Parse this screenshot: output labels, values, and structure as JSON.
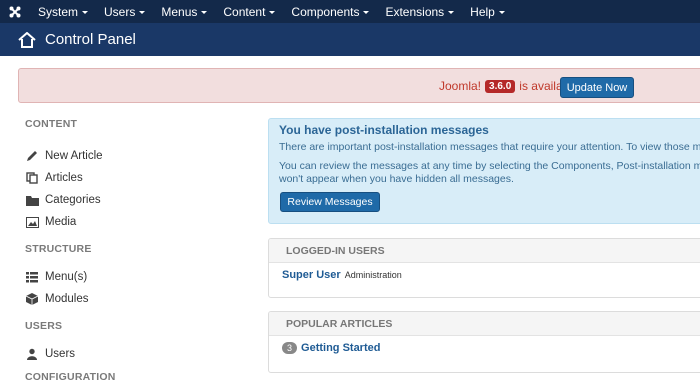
{
  "top_menu": {
    "items": [
      {
        "label": "System"
      },
      {
        "label": "Users"
      },
      {
        "label": "Menus"
      },
      {
        "label": "Content"
      },
      {
        "label": "Components"
      },
      {
        "label": "Extensions"
      },
      {
        "label": "Help"
      }
    ]
  },
  "header": {
    "title": "Control Panel"
  },
  "update_bar": {
    "prefix": "Joomla!",
    "version": "3.6.0",
    "suffix": "is available:",
    "button": "Update Now"
  },
  "sidebar": {
    "content_heading": "CONTENT",
    "content_items": [
      {
        "label": "New Article",
        "icon": "pencil-icon"
      },
      {
        "label": "Articles",
        "icon": "copy-icon"
      },
      {
        "label": "Categories",
        "icon": "folder-icon"
      },
      {
        "label": "Media",
        "icon": "image-icon"
      }
    ],
    "structure_heading": "STRUCTURE",
    "structure_items": [
      {
        "label": "Menu(s)",
        "icon": "list-icon"
      },
      {
        "label": "Modules",
        "icon": "cube-icon"
      }
    ],
    "users_heading": "USERS",
    "users_items": [
      {
        "label": "Users",
        "icon": "user-icon"
      }
    ],
    "configuration_heading": "CONFIGURATION"
  },
  "post_install": {
    "title": "You have post-installation messages",
    "line1": "There are important post-installation messages that require your attention. To view those messa",
    "line2": "You can review the messages at any time by selecting the Components, Post-installation messa",
    "line3": "won't appear when you have hidden all messages.",
    "button": "Review Messages"
  },
  "logged_in": {
    "heading": "LOGGED-IN USERS",
    "user": "Super User",
    "location": "Administration"
  },
  "popular": {
    "heading": "POPULAR ARTICLES",
    "count": "3",
    "article": "Getting Started"
  },
  "colors": {
    "topbar": "#13294a",
    "header": "#1a3867",
    "primary_button": "#1f6aa8",
    "alert_bg": "#f2dede",
    "info_bg": "#d8edf8"
  }
}
